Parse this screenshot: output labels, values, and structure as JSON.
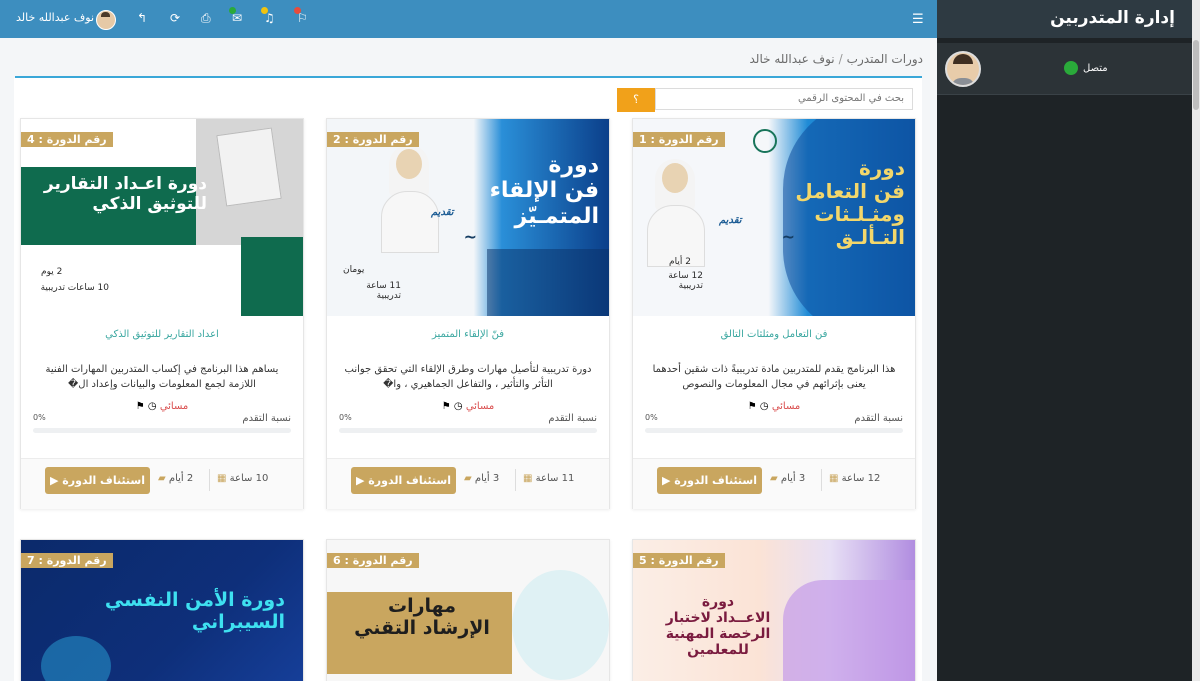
{
  "top_bar": {
    "user_name": "نوف عبدالله خالد",
    "menu_icon": "hamburger-icon",
    "icons": [
      "reply-icon",
      "refresh-icon",
      "print-icon",
      "inbox-icon",
      "bell-icon",
      "flag-icon"
    ],
    "colors": {
      "bar": "#3d8ebf",
      "badge_green": "#2aaa3a",
      "badge_yellow": "#f1c40f",
      "badge_red": "#e74c3c"
    }
  },
  "sidebar": {
    "title": "إدارة المتدربين",
    "status_label": "متصل",
    "status_color": "#2aaa3a"
  },
  "breadcrumb": {
    "item1": "دورات المتدرب",
    "separator": "/",
    "item2": "نوف عبدالله خالد"
  },
  "search": {
    "placeholder": "بحث في المحتوى الرقمي",
    "button": "؟"
  },
  "cards": [
    {
      "badge": "رقم الدورة : 1",
      "img_title": "دورة\nفن التعامل\nومثـلـثات\nالتـألـق",
      "img_presenter": "تقديم",
      "img_stats": [
        "2 أيام",
        "12 ساعة تدريبية"
      ],
      "title": "فن التعامل ومثلثات التالق",
      "desc": "هذا البرنامج يقدم للمتدربين مادة تدريبيةً ذات شقين أحدهما يعنى بإثرائهم في مجال المعلومات والنصوص",
      "meta": "مسائي",
      "progress_label": "نسبة التقدم",
      "progress_pct": "0%",
      "progress_value": 0,
      "resume": "استئناف الدورة",
      "days": "3 أيام",
      "hours": "12 ساعة"
    },
    {
      "badge": "رقم الدورة : 2",
      "img_title": "دورة\nفن الإلقاء\nالمتمـيّز",
      "img_presenter": "تقديم",
      "img_stats": [
        "يومان",
        "11 ساعة تدريبية"
      ],
      "title": "فنّ الإلقاء المتميز",
      "desc": "دورة تدريبية لتأصيل مهارات وطرق الإلقاء التي تحقق جوانب التأثر والتأثير ، والتفاعل الجماهيري ، وا�",
      "meta": "مسائي",
      "progress_label": "نسبة التقدم",
      "progress_pct": "0%",
      "progress_value": 0,
      "resume": "استئناف الدورة",
      "days": "3 أيام",
      "hours": "11 ساعة"
    },
    {
      "badge": "رقم الدورة : 4",
      "img_title": "دورة اعـداد التقارير\nللتوثيق الذكي",
      "img_presenter": "",
      "img_stats": [
        "2 يوم",
        "10 ساعات تدريبية"
      ],
      "title": "اعداد التقارير للتوثيق الذكي",
      "desc": "يساهم هذا البرنامج في إكساب المتدربين المهارات الفنية اللازمة لجمع المعلومات والبيانات وإعداد ال�",
      "meta": "مسائي",
      "progress_label": "نسبة التقدم",
      "progress_pct": "0%",
      "progress_value": 0,
      "resume": "استئناف الدورة",
      "days": "2 أيام",
      "hours": "10 ساعة"
    },
    {
      "badge": "رقم الدورة : 5",
      "img_title": "دورة\nالاعــداد لاختبار\nالرخصة المهنية للمعلمين"
    },
    {
      "badge": "رقم الدورة : 6",
      "img_title": "مهارات\nالإرشاد التقني"
    },
    {
      "badge": "رقم الدورة : 7",
      "img_title": "دورة الأمن النفسي\nالسيبراني"
    }
  ]
}
